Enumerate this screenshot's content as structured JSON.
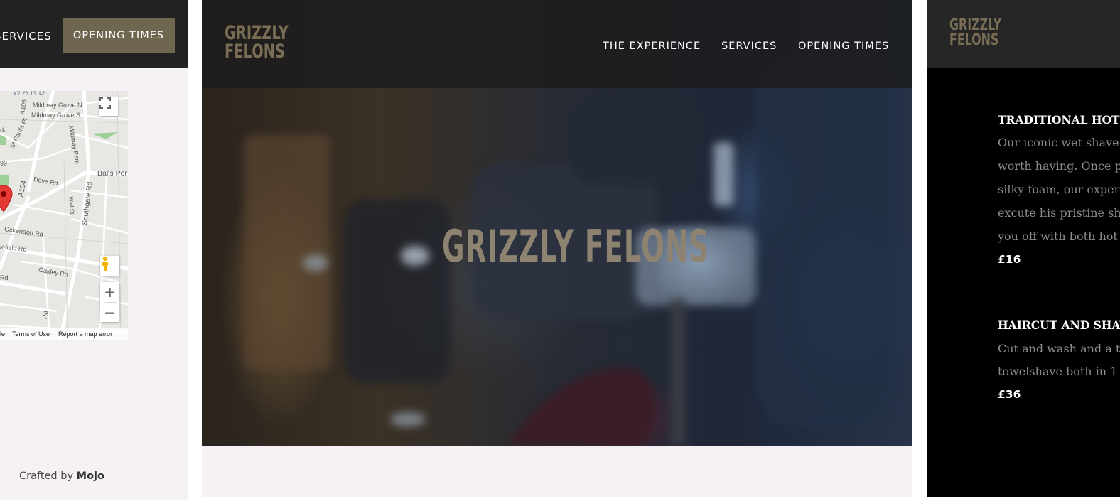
{
  "left_panel": {
    "nav": {
      "services_label": "SERVICES",
      "opening_times_label": "OPENING TIMES"
    },
    "map": {
      "labels": {
        "ward": "WARD",
        "mildmay_grove_n": "Mildmay Grove N",
        "mildmay_grove_s": "Mildmay Grove S",
        "a105": "A105",
        "st_pauls_pl": "St Paul's Pl",
        "mildmay_park": "Mildmay Park",
        "balls_pond": "Balls Por",
        "dove_rd": "Dove Rd",
        "a104": "A104",
        "wall_st": "Wall St",
        "southgate_rd": "Southgate Rd",
        "ockendon_rd": "Ockendon Rd",
        "clifield_rd": "lefield Rd",
        "oakley_rd": "Oakley Rd",
        "rd": "Rd",
        "ark": "rk",
        "ninety_nine": "99",
        "hertford_rd": "Rd"
      },
      "fullscreen_icon": "fullscreen-icon",
      "pegman_icon": "pegman-icon",
      "zoom_in_label": "+",
      "zoom_out_label": "−",
      "footer": {
        "google_fragment": "le",
        "terms_label": "Terms of Use",
        "report_label": "Report a map error"
      },
      "colors": {
        "marker": "#e53935",
        "park": "#9ed19a"
      }
    },
    "crafted_prefix": "Crafted by",
    "crafted_brand": "Mojo"
  },
  "center_panel": {
    "logo_line1": "GRIZZLY",
    "logo_line2": "FELONS",
    "nav": {
      "experience_label": "THE EXPERIENCE",
      "services_label": "SERVICES",
      "opening_times_label": "OPENING TIMES"
    },
    "hero_title": "GRIZZLY FELONS"
  },
  "right_panel": {
    "logo_line1": "GRIZZLY",
    "logo_line2": "FELONS",
    "services": [
      {
        "title": "TRADITIONAL HOT T",
        "lines": [
          "Our iconic wet shave",
          "worth having. Once p",
          "silky foam, our exper",
          "excute his pristine sh",
          "you off with both hot"
        ],
        "price": "£16"
      },
      {
        "title": "HAIRCUT AND SHAV",
        "lines": [
          "Cut and wash and a t",
          "towelshave both in 1"
        ],
        "price": "£36"
      }
    ]
  },
  "colors": {
    "accent": "#6f6650",
    "logo": "#7a6d55",
    "dark_bar": "#222222",
    "panel_bg": "#f6f1f5"
  }
}
